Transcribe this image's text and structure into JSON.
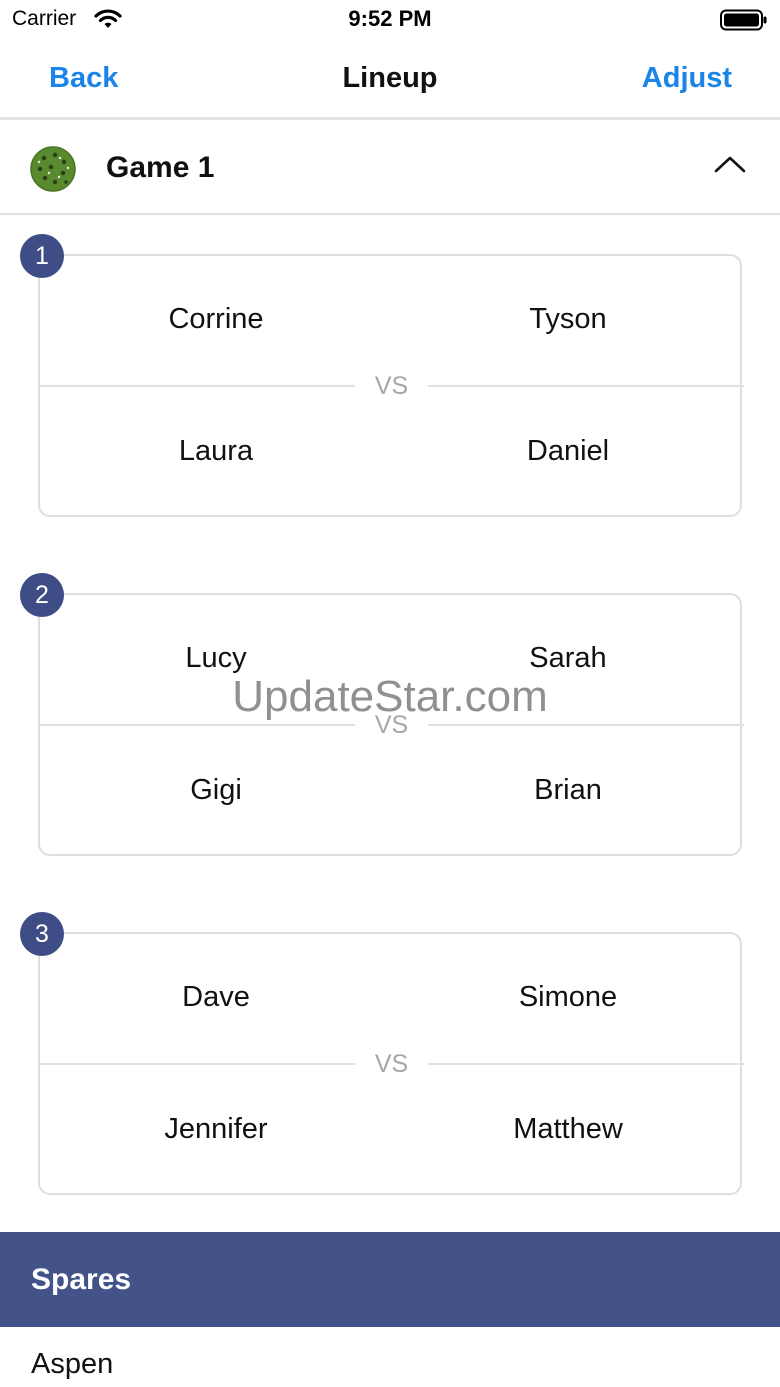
{
  "status_bar": {
    "carrier": "Carrier",
    "time": "9:52 PM"
  },
  "nav": {
    "back_label": "Back",
    "title": "Lineup",
    "adjust_label": "Adjust"
  },
  "game": {
    "title": "Game 1",
    "icon": "pickleball-icon",
    "expanded_icon": "chevron-up-icon"
  },
  "courts": [
    {
      "number": "1",
      "top_left": "Corrine",
      "top_right": "Tyson",
      "vs": "VS",
      "bottom_left": "Laura",
      "bottom_right": "Daniel"
    },
    {
      "number": "2",
      "top_left": "Lucy",
      "top_right": "Sarah",
      "vs": "VS",
      "bottom_left": "Gigi",
      "bottom_right": "Brian"
    },
    {
      "number": "3",
      "top_left": "Dave",
      "top_right": "Simone",
      "vs": "VS",
      "bottom_left": "Jennifer",
      "bottom_right": "Matthew"
    }
  ],
  "watermark": "UpdateStar.com",
  "spares": {
    "title": "Spares",
    "items": [
      "Aspen"
    ]
  },
  "colors": {
    "accent": "#1a84e8",
    "badge": "#3e4d86",
    "spares_header": "#43538a",
    "ball": "#5a8a2e"
  }
}
